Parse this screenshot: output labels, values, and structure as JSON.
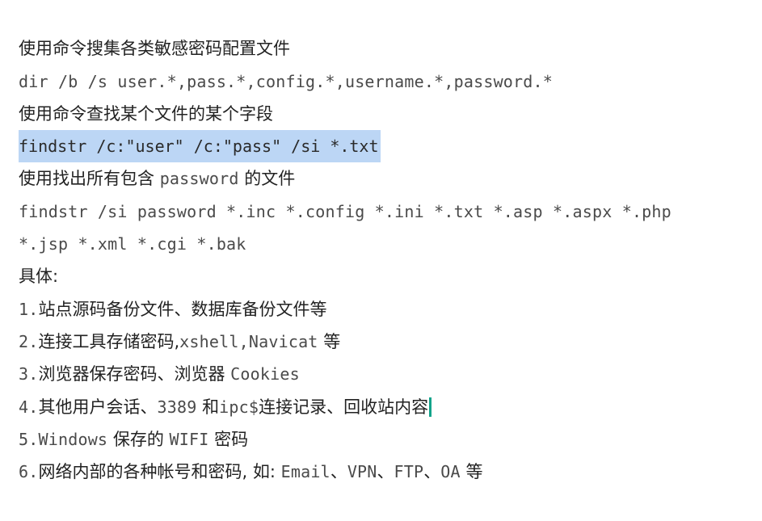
{
  "lines": {
    "l1": "使用命令搜集各类敏感密码配置文件",
    "l2": "dir /b /s user.*,pass.*,config.*,username.*,password.*",
    "l3": "使用命令查找某个文件的某个字段",
    "l4": "findstr /c:\"user\" /c:\"pass\" /si *.txt",
    "l5a": "使用找出所有包含 ",
    "l5b": "password",
    "l5c": " 的文件",
    "l6": "findstr /si password *.inc *.config *.ini *.txt *.asp *.aspx *.php",
    "l7": "*.jsp *.xml *.cgi *.bak",
    "l8": "具体:",
    "l9a": "1.",
    "l9b": "站点源码备份文件、数据库备份文件等",
    "l10a": "2.",
    "l10b": "连接工具存储密码,",
    "l10c": "xshell,Navicat",
    "l10d": " 等",
    "l11a": "3.",
    "l11b": "浏览器保存密码、浏览器 ",
    "l11c": "Cookies",
    "l12a": "4.",
    "l12b": "其他用户会话、",
    "l12c": "3389",
    "l12d": " 和",
    "l12e": "ipc$",
    "l12f": "连接记录、回收站内容",
    "l13a": "5.",
    "l13b": "Windows",
    "l13c": " 保存的 ",
    "l13d": "WIFI",
    "l13e": " 密码",
    "l14a": "6.",
    "l14b": "网络内部的各种帐号和密码, 如: ",
    "l14c": "Email",
    "l14d": "、",
    "l14e": "VPN",
    "l14f": "、",
    "l14g": "FTP",
    "l14h": "、",
    "l14i": "OA",
    "l14j": " 等"
  },
  "colors": {
    "highlight": "#bcd6f5",
    "caret": "#12a38a",
    "text": "#222222",
    "code": "#4a4a4a"
  }
}
